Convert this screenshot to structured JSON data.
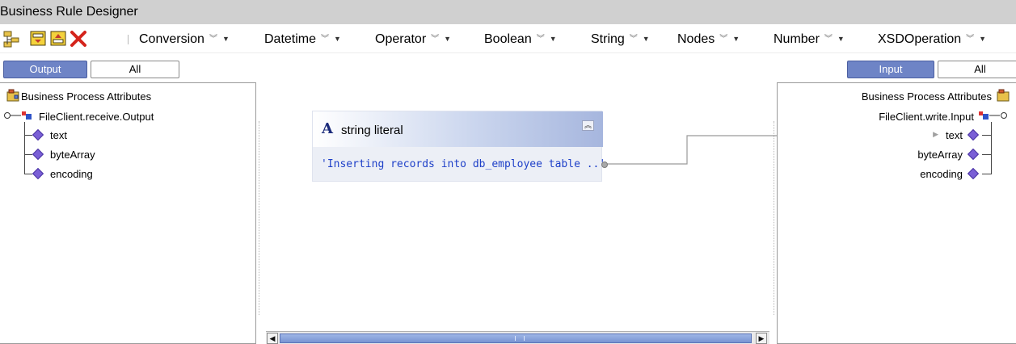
{
  "window": {
    "title": "Business Rule Designer"
  },
  "toolbar": {
    "icons": [
      "tree-icon",
      "open-rule-icon",
      "save-rule-icon",
      "delete-icon"
    ],
    "menus": [
      "Conversion",
      "Datetime",
      "Operator",
      "Boolean",
      "String",
      "Nodes",
      "Number",
      "XSDOperation"
    ]
  },
  "left_tabs": {
    "active": "Output",
    "inactive": "All"
  },
  "right_tabs": {
    "active": "Input",
    "inactive": "All"
  },
  "left_tree": {
    "root": "Business Process Attributes",
    "node": "FileClient.receive.Output",
    "children": [
      "text",
      "byteArray",
      "encoding"
    ]
  },
  "right_tree": {
    "root": "Business Process Attributes",
    "node": "FileClient.write.Input",
    "children": [
      "text",
      "byteArray",
      "encoding"
    ]
  },
  "canvas": {
    "node": {
      "type_icon": "A",
      "title": "string literal",
      "value": "'Inserting records into db_employee table ..'"
    }
  },
  "colors": {
    "accent": "#6e84c6",
    "port_diamond": "#7a5fd6",
    "literal_text": "#1d3fc8",
    "title_bar": "#d0d0d0"
  }
}
